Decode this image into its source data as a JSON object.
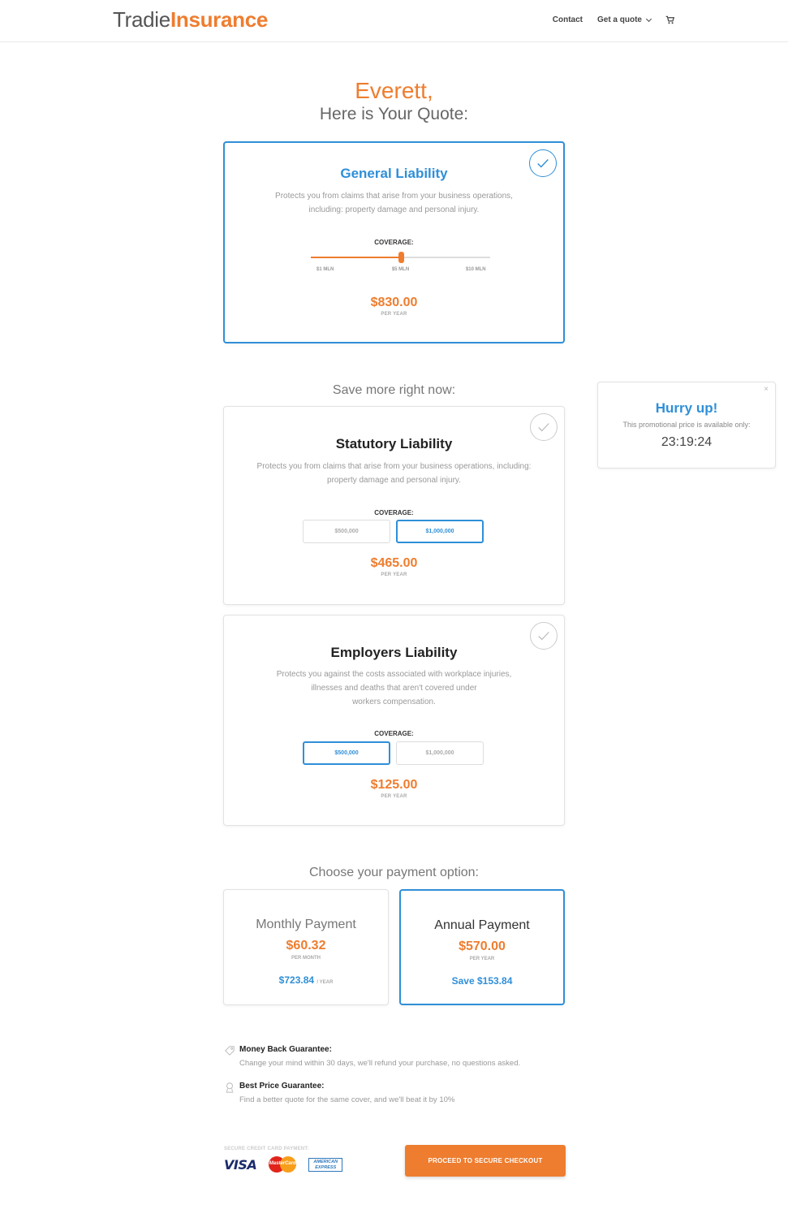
{
  "header": {
    "logo_part1": "Tradie",
    "logo_part2": "Insurance",
    "nav": {
      "contact": "Contact",
      "get_quote": "Get a quote"
    }
  },
  "greeting": {
    "name": "Everett,",
    "subtitle": "Here is Your Quote:"
  },
  "general_liability": {
    "title": "General Liability",
    "description": "Protects you from claims that arise from your business operations, including: property damage and personal injury.",
    "coverage_label": "COVERAGE:",
    "slider_ticks": [
      "$1 MLN",
      "$5 MLN",
      "$10 MLN"
    ],
    "slider_value_fraction": 0.5,
    "price": "$830.00",
    "per": "PER YEAR",
    "selected": true
  },
  "save_more_title": "Save more right now:",
  "statutory_liability": {
    "title": "Statutory Liability",
    "description": "Protects you from claims that arise from your business operations, including: property damage and personal injury.",
    "coverage_label": "COVERAGE:",
    "options": [
      "$500,000",
      "$1,000,000"
    ],
    "selected_option": "$1,000,000",
    "price": "$465.00",
    "per": "PER YEAR"
  },
  "employers_liability": {
    "title": "Employers Liability",
    "description_lines": [
      "Protects you against the costs associated with workplace injuries,",
      "illnesses and deaths that aren't covered under",
      "workers compensation."
    ],
    "coverage_label": "COVERAGE:",
    "options": [
      "$500,000",
      "$1,000,000"
    ],
    "selected_option": "$500,000",
    "price": "$125.00",
    "per": "PER YEAR"
  },
  "hurry": {
    "close": "×",
    "title": "Hurry up!",
    "text": "This promotional price is available only:",
    "timer": "23:19:24"
  },
  "payment": {
    "title": "Choose your payment option:",
    "monthly": {
      "label": "Monthly Payment",
      "price": "$60.32",
      "per": "PER MONTH",
      "yearly": "$723.84",
      "yearly_suffix": "/ YEAR"
    },
    "annual": {
      "label": "Annual Payment",
      "price": "$570.00",
      "per": "PER YEAR",
      "save": "Save $153.84",
      "selected": true
    }
  },
  "guarantees": [
    {
      "title": "Money Back Guarantee:",
      "text": "Change your mind within 30 days, we'll refund your purchase, no questions asked.",
      "icon": "tag-icon"
    },
    {
      "title": "Best Price Guarantee:",
      "text": "Find a better quote for the same cover, and we'll beat it by 10%",
      "icon": "award-icon"
    }
  ],
  "footer": {
    "secure_label": "SECURE CREDIT CARD PAYMENT:",
    "visa": "VISA",
    "mastercard": "MasterCard",
    "amex_line1": "AMERICAN",
    "amex_line2": "EXPRESS",
    "checkout": "PROCEED TO SECURE CHECKOUT"
  },
  "colors": {
    "accent_orange": "#ee7d2f",
    "accent_blue": "#2f8fd8"
  }
}
